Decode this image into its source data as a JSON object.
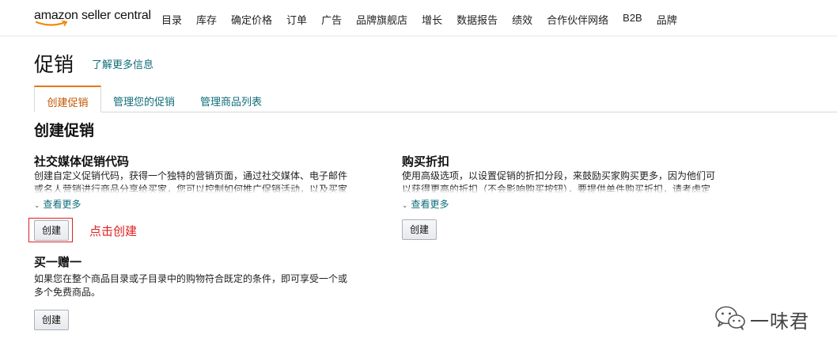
{
  "header": {
    "logo": "amazon seller central",
    "nav": [
      "目录",
      "库存",
      "确定价格",
      "订单",
      "广告",
      "品牌旗舰店",
      "增长",
      "数据报告",
      "绩效",
      "合作伙伴网络",
      "B2B",
      "品牌"
    ]
  },
  "page": {
    "title": "促销",
    "learn_more": "了解更多信息"
  },
  "tabs": [
    {
      "label": "创建促销",
      "active": true
    },
    {
      "label": "管理您的促销",
      "active": false
    },
    {
      "label": "管理商品列表",
      "active": false
    }
  ],
  "section_title": "创建促销",
  "cards": {
    "social": {
      "title": "社交媒体促销代码",
      "desc_line1": "创建自定义促销代码，获得一个独特的营销页面，通过社交媒体、电子邮件",
      "desc_line2": "或名人营销进行商品分享给买家，您可以控制如何推广促销活动，以及买家",
      "see_more": "查看更多",
      "button": "创建"
    },
    "purchase_discount": {
      "title": "购买折扣",
      "desc_line1": "使用高级选项，以设置促销的折扣分段，来鼓励买家购买更多，因为他们可",
      "desc_line2": "以获得更高的折扣（不会影响购买按钮），要提供单件购买折扣，请考虑定",
      "see_more": "查看更多",
      "button": "创建"
    },
    "bogo": {
      "title": "买一赠一",
      "desc_line1": "如果您在整个商品目录或子目录中的购物符合既定的条件，即可享受一个或",
      "desc_line2": "多个免费商品。",
      "button": "创建"
    }
  },
  "annotation": "点击创建",
  "watermark": "一味君",
  "colors": {
    "accent": "#e47911",
    "link": "#0f6d7a",
    "annotation": "#e02020"
  }
}
